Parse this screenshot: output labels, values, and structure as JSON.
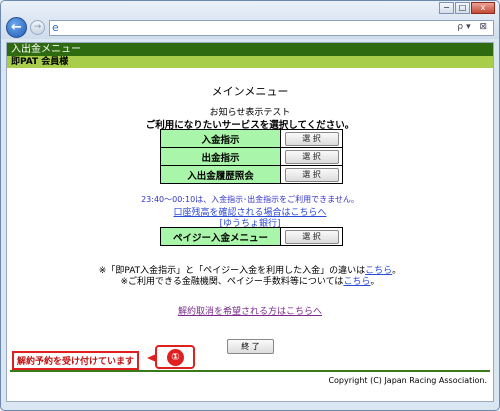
{
  "window": {
    "min": "−",
    "max": "□",
    "close": "x"
  },
  "browser": {
    "back_glyph": "←",
    "fwd_glyph": "→",
    "page_glyph": "e",
    "addr_tools": "ρ▾ ⊠"
  },
  "header": {
    "title": "入出金メニュー",
    "subtitle": "即PAT 会員様"
  },
  "main": {
    "title": "メインメニュー",
    "notice": "お知らせ表示テスト",
    "select_msg": "ご利用になりたいサービスを選択してください。"
  },
  "menu": [
    {
      "label": "入金指示",
      "button": "選 択"
    },
    {
      "label": "出金指示",
      "button": "選 択"
    },
    {
      "label": "入出金履歴照会",
      "button": "選 択"
    }
  ],
  "time_note": "23:40～00:10は、入金指示･出金指示をご利用できません。",
  "links": {
    "balance": "口座残高を確認される場合はこちらへ",
    "yucho": "[ゆうちょ銀行]"
  },
  "payeasy": {
    "label": "ペイジー入金メニュー",
    "button": "選 択"
  },
  "footer_notes": {
    "line1_pre": "※「即PAT入金指示」と「ペイジー入金を利用した入金」の違いは",
    "line1_link": "こちら",
    "line1_post": "。",
    "line2_pre": "※ご利用できる金融機関、ペイジー手数料等については",
    "line2_link": "こちら",
    "line2_post": "。"
  },
  "cancel_link": "解約取消を希望される方はこちらへ",
  "end_button": "終 了",
  "status_msg": "解約予約を受け付けています",
  "callout_number": "①",
  "copyright": "Copyright (C) Japan Racing Association."
}
